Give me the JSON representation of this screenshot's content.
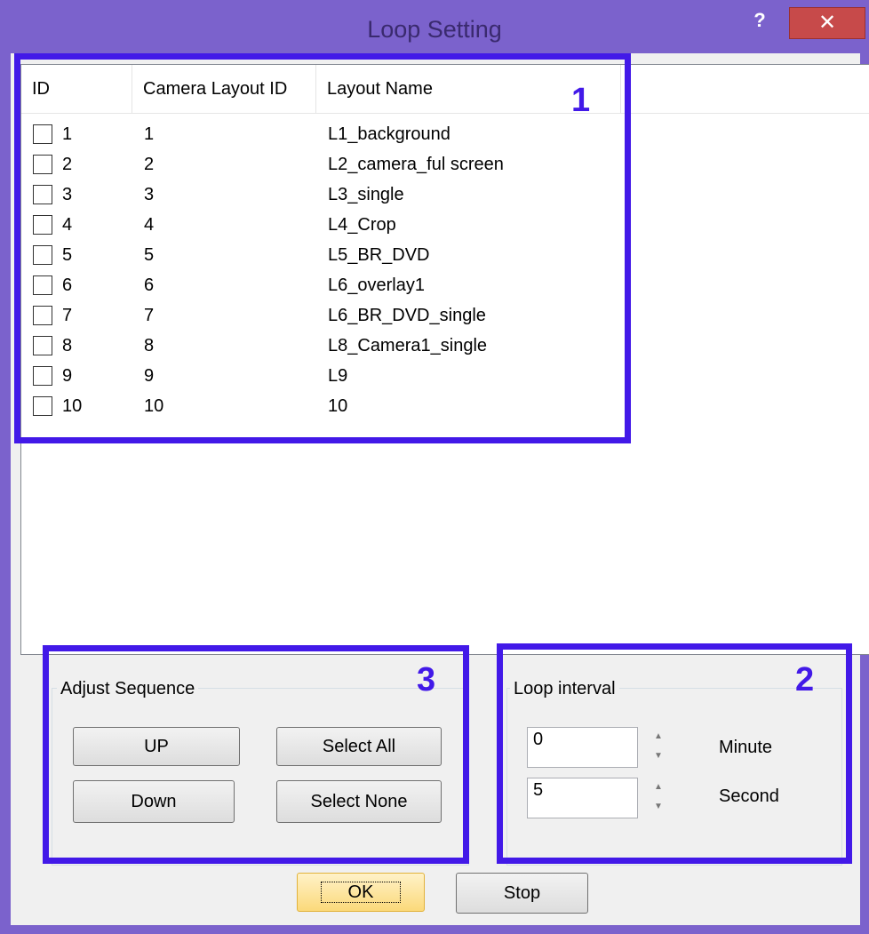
{
  "window": {
    "title": "Loop Setting",
    "help_label": "?",
    "close_label": "✕"
  },
  "list": {
    "columns": [
      "ID",
      "Camera Layout ID",
      "Layout Name"
    ],
    "rows": [
      {
        "id": "1",
        "camera_layout_id": "1",
        "layout_name": "L1_background",
        "checked": false
      },
      {
        "id": "2",
        "camera_layout_id": "2",
        "layout_name": "L2_camera_ful screen",
        "checked": false
      },
      {
        "id": "3",
        "camera_layout_id": "3",
        "layout_name": "L3_single",
        "checked": false
      },
      {
        "id": "4",
        "camera_layout_id": "4",
        "layout_name": "L4_Crop",
        "checked": false
      },
      {
        "id": "5",
        "camera_layout_id": "5",
        "layout_name": "L5_BR_DVD",
        "checked": false
      },
      {
        "id": "6",
        "camera_layout_id": "6",
        "layout_name": "L6_overlay1",
        "checked": false
      },
      {
        "id": "7",
        "camera_layout_id": "7",
        "layout_name": "L6_BR_DVD_single",
        "checked": false
      },
      {
        "id": "8",
        "camera_layout_id": "8",
        "layout_name": "L8_Camera1_single",
        "checked": false
      },
      {
        "id": "9",
        "camera_layout_id": "9",
        "layout_name": "L9",
        "checked": false
      },
      {
        "id": "10",
        "camera_layout_id": "10",
        "layout_name": "10",
        "checked": false
      }
    ]
  },
  "adjust_sequence": {
    "label": "Adjust Sequence",
    "up_label": "UP",
    "down_label": "Down",
    "select_all_label": "Select All",
    "select_none_label": "Select None"
  },
  "loop_interval": {
    "label": "Loop interval",
    "minute_value": "0",
    "minute_label": "Minute",
    "second_value": "5",
    "second_label": "Second"
  },
  "footer": {
    "ok_label": "OK",
    "stop_label": "Stop"
  },
  "annotations": {
    "box1_number": "1",
    "box2_number": "2",
    "box3_number": "3",
    "color": "#4219e8"
  }
}
